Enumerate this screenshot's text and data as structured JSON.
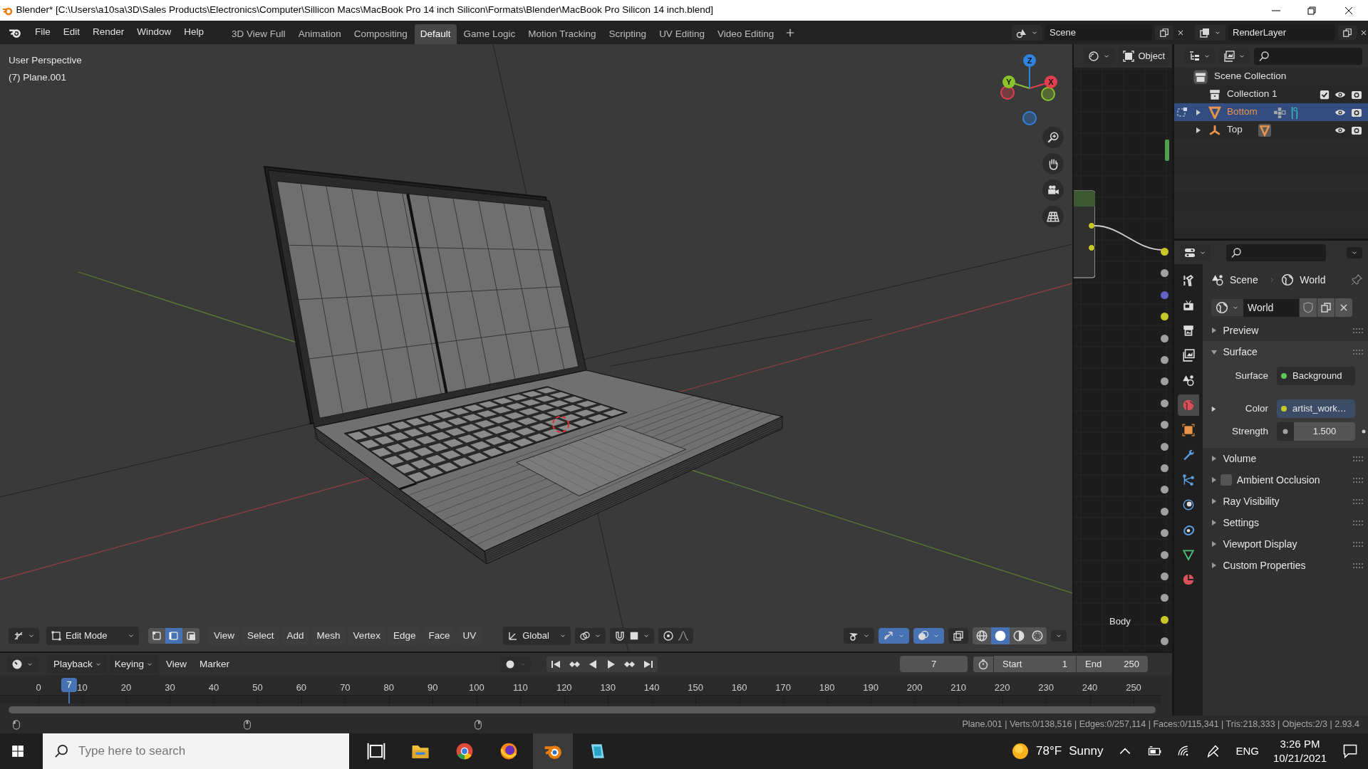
{
  "window": {
    "title": "Blender* [C:\\Users\\a10sa\\3D\\Sales Products\\Electronics\\Computer\\Sillicon Macs\\MacBook Pro 14 inch Silicon\\Formats\\Blender\\MacBook Pro Silicon 14 inch.blend]"
  },
  "menu": [
    "File",
    "Edit",
    "Render",
    "Window",
    "Help"
  ],
  "workspaces": [
    {
      "label": "3D View Full",
      "selected": false
    },
    {
      "label": "Animation",
      "selected": false
    },
    {
      "label": "Compositing",
      "selected": false
    },
    {
      "label": "Default",
      "selected": true
    },
    {
      "label": "Game Logic",
      "selected": false
    },
    {
      "label": "Motion Tracking",
      "selected": false
    },
    {
      "label": "Scripting",
      "selected": false
    },
    {
      "label": "UV Editing",
      "selected": false
    },
    {
      "label": "Video Editing",
      "selected": false
    }
  ],
  "scene_selector": {
    "value": "Scene"
  },
  "view_layer_selector": {
    "value": "RenderLayer"
  },
  "viewport": {
    "view_name": "User Perspective",
    "object_info": "(7) Plane.001",
    "gizmo_axes": [
      {
        "label": "X",
        "color": "#e2404f"
      },
      {
        "label": "Y",
        "color": "#8ac42a"
      },
      {
        "label": "Z",
        "color": "#2f82e0"
      }
    ],
    "header": {
      "mode": "Edit Mode",
      "select_modes": [
        {
          "kind": "vertex",
          "selected": false
        },
        {
          "kind": "edge",
          "selected": true
        },
        {
          "kind": "face",
          "selected": false
        }
      ],
      "menus": [
        "View",
        "Select",
        "Add",
        "Mesh",
        "Vertex",
        "Edge",
        "Face",
        "UV"
      ],
      "orientation": "Global",
      "toggles": [
        {
          "kind": "visibility",
          "selected": false
        },
        {
          "kind": "gizmos",
          "selected": true
        },
        {
          "kind": "overlays",
          "selected": true
        },
        {
          "kind": "xray",
          "selected": false
        }
      ],
      "shading": [
        {
          "kind": "wireframe",
          "selected": false
        },
        {
          "kind": "solid",
          "selected": true
        },
        {
          "kind": "material",
          "selected": false
        },
        {
          "kind": "rendered",
          "selected": false
        }
      ]
    }
  },
  "node_editor": {
    "object_button": "Object",
    "label": "Body",
    "sockets": [
      {
        "color": "#c7c729"
      },
      {
        "color": "#a1a1a1"
      },
      {
        "color": "#6363c7"
      },
      {
        "color": "#c7c729"
      },
      {
        "color": "#a1a1a1"
      },
      {
        "color": "#a1a1a1"
      },
      {
        "color": "#a1a1a1"
      },
      {
        "color": "#a1a1a1"
      },
      {
        "color": "#a1a1a1"
      },
      {
        "color": "#a1a1a1"
      },
      {
        "color": "#a1a1a1"
      },
      {
        "color": "#a1a1a1"
      },
      {
        "color": "#a1a1a1"
      },
      {
        "color": "#a1a1a1"
      },
      {
        "color": "#a1a1a1"
      },
      {
        "color": "#a1a1a1"
      },
      {
        "color": "#a1a1a1"
      },
      {
        "color": "#c7c729"
      },
      {
        "color": "#a1a1a1"
      }
    ]
  },
  "outliner": {
    "items": [
      {
        "name": "Scene Collection",
        "kind": "scene_collection",
        "selected": false,
        "children": [
          {
            "name": "Collection 1",
            "kind": "collection",
            "selected": false,
            "checked": true,
            "visible": true,
            "renderable": true
          },
          {
            "name": "Bottom",
            "kind": "mesh",
            "selected": true,
            "expanded": false,
            "badges": [
              {
                "kind": "modifiers"
              },
              {
                "kind": "hook"
              }
            ],
            "visible": true,
            "renderable": true
          },
          {
            "name": "Top",
            "kind": "empty",
            "selected": false,
            "expanded": false,
            "badges": [
              {
                "kind": "mesh"
              }
            ],
            "visible": true,
            "renderable": true
          }
        ]
      }
    ]
  },
  "properties": {
    "tabs": [
      {
        "kind": "tool",
        "selected": false
      },
      {
        "kind": "render",
        "selected": false
      },
      {
        "kind": "output",
        "selected": false
      },
      {
        "kind": "view_layer",
        "selected": false
      },
      {
        "kind": "scene",
        "selected": false
      },
      {
        "kind": "world",
        "selected": true
      },
      {
        "kind": "object",
        "selected": false
      },
      {
        "kind": "modifiers",
        "selected": false
      },
      {
        "kind": "particles",
        "selected": false
      },
      {
        "kind": "physics",
        "selected": false
      },
      {
        "kind": "constraints",
        "selected": false
      },
      {
        "kind": "data",
        "selected": false
      },
      {
        "kind": "material",
        "selected": false
      }
    ],
    "breadcrumb": [
      {
        "kind": "scene",
        "label": "Scene"
      },
      {
        "kind": "world",
        "label": "World"
      }
    ],
    "datablock": {
      "value": "World"
    },
    "panels": [
      {
        "title": "Preview",
        "expanded": false
      },
      {
        "title": "Surface",
        "expanded": true,
        "fields": [
          {
            "kind": "link",
            "label": "Surface",
            "value": "Background",
            "color": "#5ac85a"
          },
          {
            "kind": "link",
            "label": "Color",
            "value": "artist_work…",
            "color": "#c7c729",
            "expanded": false
          },
          {
            "kind": "number",
            "label": "Strength",
            "value": "1.500"
          }
        ]
      },
      {
        "title": "Volume",
        "expanded": false
      },
      {
        "title": "Ambient Occlusion",
        "expanded": false,
        "checked": false
      },
      {
        "title": "Ray Visibility",
        "expanded": false
      },
      {
        "title": "Settings",
        "expanded": false
      },
      {
        "title": "Viewport Display",
        "expanded": false
      },
      {
        "title": "Custom Properties",
        "expanded": false
      }
    ]
  },
  "timeline": {
    "menus": [
      {
        "label": "Playback",
        "kind": "dropdown"
      },
      {
        "label": "Keying",
        "kind": "dropdown"
      },
      {
        "label": "View",
        "kind": "menu"
      },
      {
        "label": "Marker",
        "kind": "menu"
      }
    ],
    "current_frame": "7",
    "start": {
      "label": "Start",
      "value": "1"
    },
    "end": {
      "label": "End",
      "value": "250"
    },
    "playhead": {
      "label": "7",
      "level": 0.028
    },
    "ticks": [
      "0",
      "10",
      "20",
      "30",
      "40",
      "50",
      "60",
      "70",
      "80",
      "90",
      "100",
      "110",
      "120",
      "130",
      "140",
      "150",
      "160",
      "170",
      "180",
      "190",
      "200",
      "210",
      "220",
      "230",
      "240",
      "250"
    ]
  },
  "status_bar": {
    "stats": "Plane.001 | Verts:0/138,516 | Edges:0/257,114 | Faces:0/115,341 | Tris:218,333 | Objects:2/3 | 2.93.4"
  },
  "taskbar": {
    "search": {
      "placeholder": "Type here to search"
    },
    "apps": [
      {
        "kind": "task_view",
        "selected": false
      },
      {
        "kind": "file_explorer",
        "selected": false
      },
      {
        "kind": "chrome",
        "selected": false
      },
      {
        "kind": "firefox",
        "selected": false
      },
      {
        "kind": "blender",
        "selected": true
      },
      {
        "kind": "notes",
        "selected": false
      }
    ],
    "weather": {
      "temperature": "78°F",
      "condition": "Sunny"
    },
    "language": "ENG",
    "time": "3:26 PM",
    "date": "10/21/2021"
  }
}
